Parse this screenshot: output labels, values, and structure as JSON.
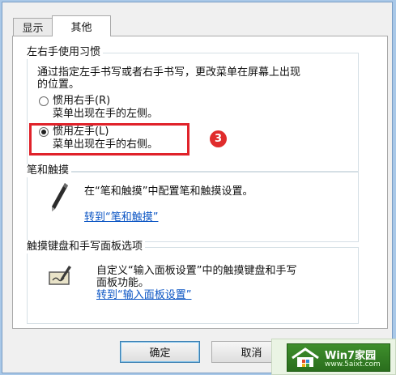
{
  "tabs": [
    {
      "label": "显示"
    },
    {
      "label": "其他"
    }
  ],
  "handedness": {
    "legend": "左右手使用习惯",
    "description_line1": "通过指定左手书写或者右手书写，更改菜单在屏幕上出现",
    "description_line2": "的位置。",
    "right_hand": {
      "label": "惯用右手(R)",
      "sub": "菜单出现在手的左侧。",
      "checked": false
    },
    "left_hand": {
      "label": "惯用左手(L)",
      "sub": "菜单出现在手的右侧。",
      "checked": true
    },
    "step_badge": "3"
  },
  "pen_touch": {
    "legend": "笔和触摸",
    "description": "在“笔和触摸”中配置笔和触摸设置。",
    "link": "转到“笔和触摸”",
    "icon": "pen-icon"
  },
  "input_panel": {
    "legend": "触摸键盘和手写面板选项",
    "description_line1": "自定义“输入面板设置”中的触摸键盘和手写",
    "description_line2": "面板功能。",
    "link": "转到“输入面板设置”",
    "icon": "tablet-pen-icon"
  },
  "buttons": {
    "ok": "确定",
    "cancel": "取消"
  },
  "watermark": {
    "title": "Win7家园",
    "url": "www.5aixt.com"
  },
  "colors": {
    "highlight": "#e0222a",
    "link": "#0b55c4",
    "badge": "#e02c2c"
  }
}
